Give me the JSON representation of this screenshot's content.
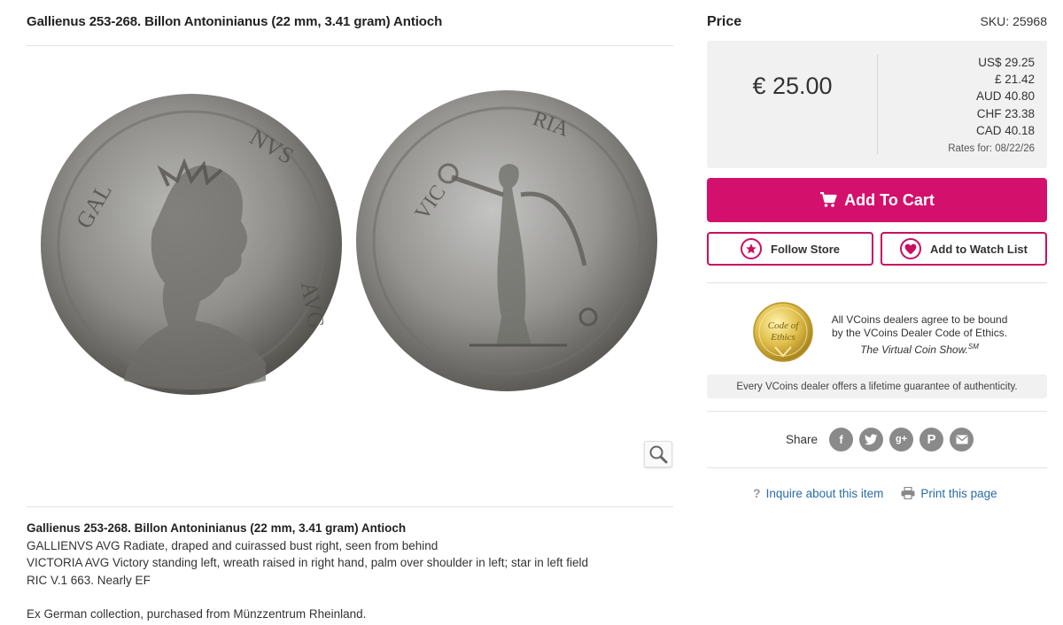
{
  "product": {
    "title": "Gallienus 253-268. Billon Antoninianus (22 mm, 3.41 gram) Antioch",
    "description": {
      "title": "Gallienus 253-268. Billon Antoninianus (22 mm, 3.41 gram) Antioch",
      "lines": [
        "GALLIENVS AVG Radiate, draped and cuirassed bust right, seen from behind",
        "VICTORIA AVG Victory standing left, wreath raised in right hand, palm over shoulder in left; star in left field",
        "RIC V.1 663. Nearly EF"
      ],
      "provenance": "Ex German collection, purchased from Münzzentrum Rheinland."
    }
  },
  "pricing": {
    "label": "Price",
    "sku": "SKU: 25968",
    "main": "€ 25.00",
    "rates": [
      "US$ 29.25",
      "£ 21.42",
      "AUD 40.80",
      "CHF 23.38",
      "CAD 40.18"
    ],
    "rates_date": "Rates for: 08/22/26"
  },
  "actions": {
    "add_to_cart": "Add To Cart",
    "follow_store": "Follow Store",
    "watch_list": "Add to Watch List"
  },
  "ethics": {
    "seal_line1": "Code of",
    "seal_line2": "Ethics",
    "text1": "All VCoins dealers agree to be bound",
    "text2": "by the VCoins Dealer Code of Ethics.",
    "text3": "The Virtual Coin Show.",
    "text3_sup": "SM",
    "guarantee": "Every VCoins dealer offers a lifetime guarantee of authenticity."
  },
  "share": {
    "label": "Share",
    "icons": [
      "facebook-icon",
      "twitter-icon",
      "google-plus-icon",
      "pinterest-icon",
      "email-icon"
    ]
  },
  "links": {
    "inquire": "Inquire about this item",
    "print": "Print this page"
  },
  "colors": {
    "accent": "#d3106b",
    "link": "#2b6aa8",
    "panel": "#f1f1f1"
  }
}
